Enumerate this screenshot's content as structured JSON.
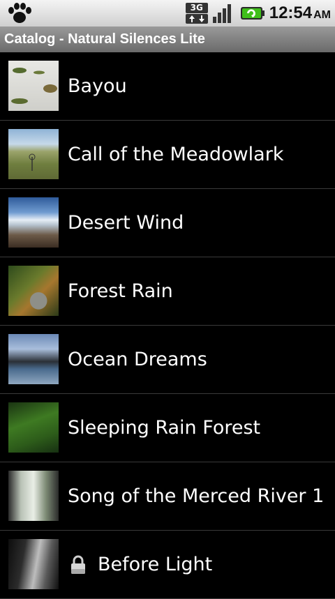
{
  "status_bar": {
    "network_type": "3G",
    "time": "12:54",
    "ampm": "AM",
    "icons": [
      "paw-icon",
      "3g-icon",
      "signal-icon",
      "battery-charging-icon"
    ]
  },
  "title_bar": {
    "title": "Catalog - Natural Silences Lite"
  },
  "catalog": {
    "items": [
      {
        "label": "Bayou",
        "locked": false
      },
      {
        "label": "Call of the Meadowlark",
        "locked": false
      },
      {
        "label": "Desert Wind",
        "locked": false
      },
      {
        "label": "Forest Rain",
        "locked": false
      },
      {
        "label": "Ocean Dreams",
        "locked": false
      },
      {
        "label": "Sleeping Rain Forest",
        "locked": false
      },
      {
        "label": "Song of the Merced River 1",
        "locked": false
      },
      {
        "label": "Before Light",
        "locked": true
      }
    ]
  },
  "colors": {
    "background": "#000000",
    "status_bar": "#dcdcdc",
    "title_bar": "#7f7f7f",
    "battery_green": "#3fbf1a",
    "divider": "#3a3a3a"
  }
}
